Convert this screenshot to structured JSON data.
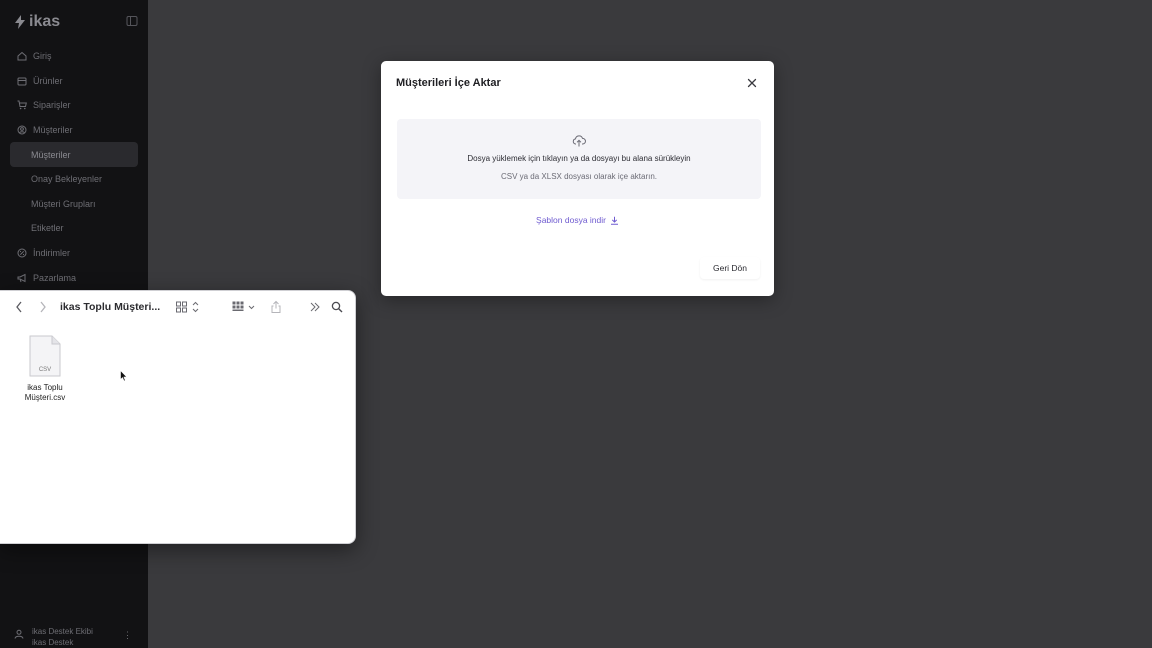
{
  "app": {
    "logo_text": "ikas"
  },
  "sidebar": {
    "items": [
      {
        "label": "Giriş",
        "icon": "home-icon",
        "sub": false,
        "active": false
      },
      {
        "label": "Ürünler",
        "icon": "box-icon",
        "sub": false,
        "active": false
      },
      {
        "label": "Siparişler",
        "icon": "cart-icon",
        "sub": false,
        "active": false
      },
      {
        "label": "Müşteriler",
        "icon": "customers-icon",
        "sub": false,
        "active": false
      },
      {
        "label": "Müşteriler",
        "icon": "",
        "sub": true,
        "active": true
      },
      {
        "label": "Onay Bekleyenler",
        "icon": "",
        "sub": true,
        "active": false
      },
      {
        "label": "Müşteri Grupları",
        "icon": "",
        "sub": true,
        "active": false
      },
      {
        "label": "Etiketler",
        "icon": "",
        "sub": true,
        "active": false
      },
      {
        "label": "İndirimler",
        "icon": "discount-icon",
        "sub": false,
        "active": false
      },
      {
        "label": "Pazarlama",
        "icon": "megaphone-icon",
        "sub": false,
        "active": false
      }
    ],
    "user": {
      "name": "ikas Destek Ekibi",
      "subtitle": "ikas Destek"
    }
  },
  "modal": {
    "title": "Müşterileri İçe Aktar",
    "dropzone_line1": "Dosya yüklemek için tıklayın ya da dosyayı bu alana sürükleyin",
    "dropzone_line2": "CSV ya da XLSX dosyası olarak içe aktarın.",
    "template_link": "Şablon dosya indir",
    "back_button": "Geri Dön"
  },
  "finder": {
    "title": "ikas Toplu Müşteri...",
    "file": {
      "icon_label": "CSV",
      "name_line1": "ikas Toplu",
      "name_line2": "Müşteri.csv"
    }
  },
  "colors": {
    "overlay": "#3a3a3d",
    "sidebar": "#121214",
    "link": "#6f5bd0"
  }
}
